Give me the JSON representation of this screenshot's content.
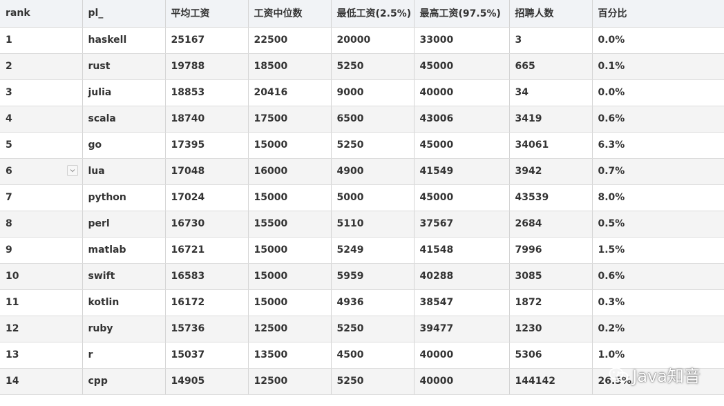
{
  "table": {
    "columns": [
      "rank",
      "pl_",
      "平均工资",
      "工资中位数",
      "最低工资(2.5%)",
      "最高工资(97.5%)",
      "招聘人数",
      "百分比"
    ],
    "rows": [
      [
        "1",
        "haskell",
        "25167",
        "22500",
        "20000",
        "33000",
        "3",
        "0.0%"
      ],
      [
        "2",
        "rust",
        "19788",
        "18500",
        "5250",
        "45000",
        "665",
        "0.1%"
      ],
      [
        "3",
        "julia",
        "18853",
        "20416",
        "9000",
        "40000",
        "34",
        "0.0%"
      ],
      [
        "4",
        "scala",
        "18740",
        "17500",
        "6500",
        "43006",
        "3419",
        "0.6%"
      ],
      [
        "5",
        "go",
        "17395",
        "15000",
        "5250",
        "45000",
        "34061",
        "6.3%"
      ],
      [
        "6",
        "lua",
        "17048",
        "16000",
        "4900",
        "41549",
        "3942",
        "0.7%"
      ],
      [
        "7",
        "python",
        "17024",
        "15000",
        "5000",
        "45000",
        "43539",
        "8.0%"
      ],
      [
        "8",
        "perl",
        "16730",
        "15500",
        "5110",
        "37567",
        "2684",
        "0.5%"
      ],
      [
        "9",
        "matlab",
        "16721",
        "15000",
        "5249",
        "41548",
        "7996",
        "1.5%"
      ],
      [
        "10",
        "swift",
        "16583",
        "15000",
        "5959",
        "40288",
        "3085",
        "0.6%"
      ],
      [
        "11",
        "kotlin",
        "16172",
        "15000",
        "4936",
        "38547",
        "1872",
        "0.3%"
      ],
      [
        "12",
        "ruby",
        "15736",
        "12500",
        "5250",
        "39477",
        "1230",
        "0.2%"
      ],
      [
        "13",
        "r",
        "15037",
        "13500",
        "4500",
        "40000",
        "5306",
        "1.0%"
      ],
      [
        "14",
        "cpp",
        "14905",
        "12500",
        "5250",
        "40000",
        "144142",
        "26.5%"
      ]
    ],
    "dropdown_row_index": 5
  },
  "watermark": {
    "text": "Java知音",
    "icon": "wechat-icon"
  }
}
